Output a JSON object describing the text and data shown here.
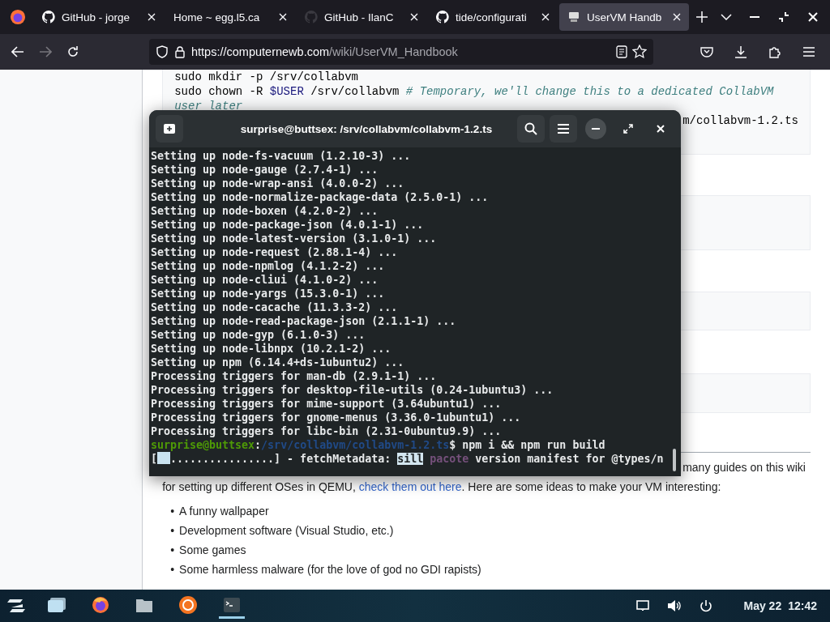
{
  "browser": {
    "tabs": [
      {
        "title": "GitHub - jorge",
        "kind": "github",
        "selected": false
      },
      {
        "title": "Home ~ egg.l5.ca",
        "kind": "plain",
        "selected": false
      },
      {
        "title": "GitHub - IlanC",
        "kind": "dim",
        "selected": false
      },
      {
        "title": "tide/configurati",
        "kind": "github",
        "selected": false
      },
      {
        "title": "UserVM Handb",
        "kind": "wiki",
        "selected": true
      }
    ],
    "url_host": "https://computernewb.com",
    "url_path": "/wiki/UserVM_Handbook"
  },
  "page": {
    "code_lines": [
      {
        "kind": "plain",
        "text": "sudo mkdir -p /srv/collabvm"
      },
      {
        "kind": "chown",
        "cmd": "sudo chown -R ",
        "var": "$USER",
        "rest": " /srv/collabvm ",
        "comment": "# Temporary, we'll change this to a dedicated CollabVM user later"
      },
      {
        "kind": "tail",
        "text": "m/collabvm-1.2.ts"
      }
    ],
    "paragraph_tail": "many guides on this wiki",
    "paragraph": {
      "before": "for setting up different OSes in QEMU, ",
      "link": "check them out here",
      "after": ". Here are some ideas to make your VM interesting:"
    },
    "list": [
      {
        "bullet": "•",
        "text": "A funny wallpaper"
      },
      {
        "bullet": "•",
        "text": "Development software (Visual Studio, etc.)"
      },
      {
        "bullet": "•",
        "text": "Some games"
      },
      {
        "bullet": "•",
        "text": "Some harmless malware (for the love of god no GDI rapists)"
      }
    ]
  },
  "terminal": {
    "title": "surprise@buttsex: /srv/collabvm/collabvm-1.2.ts",
    "lines": [
      "Setting up node-fs-vacuum (1.2.10-3) ...",
      "Setting up node-gauge (2.7.4-1) ...",
      "Setting up node-wrap-ansi (4.0.0-2) ...",
      "Setting up node-normalize-package-data (2.5.0-1) ...",
      "Setting up node-boxen (4.2.0-2) ...",
      "Setting up node-package-json (4.0.1-1) ...",
      "Setting up node-latest-version (3.1.0-1) ...",
      "Setting up node-request (2.88.1-4) ...",
      "Setting up node-npmlog (4.1.2-2) ...",
      "Setting up node-cliui (4.1.0-2) ...",
      "Setting up node-yargs (15.3.0-1) ...",
      "Setting up node-cacache (11.3.3-2) ...",
      "Setting up node-read-package-json (2.1.1-1) ...",
      "Setting up node-gyp (6.1.0-3) ...",
      "Setting up node-libnpx (10.2.1-2) ...",
      "Setting up npm (6.14.4+ds-1ubuntu2) ...",
      "Processing triggers for man-db (2.9.1-1) ...",
      "Processing triggers for desktop-file-utils (0.24-1ubuntu3) ...",
      "Processing triggers for mime-support (3.64ubuntu1) ...",
      "Processing triggers for gnome-menus (3.36.0-1ubuntu1) ...",
      "Processing triggers for libc-bin (2.31-0ubuntu9.9) ..."
    ],
    "prompt": {
      "user": "surprise@buttsex",
      "sep": ":",
      "path": "/srv/collabvm/collabvm-1.2.ts",
      "command": "$ npm i && npm run build"
    },
    "progress": {
      "open": "[",
      "dots": "................] - fetchMetadata: ",
      "level_tag": "sill",
      "module": "pacote",
      "rest": " version manifest for @types/n"
    }
  },
  "taskbar": {
    "apps": [
      {
        "kind": "windows",
        "active": false
      },
      {
        "kind": "firefox",
        "active": false
      },
      {
        "kind": "folder",
        "active": false
      },
      {
        "kind": "software",
        "active": false
      },
      {
        "kind": "terminal",
        "active": true
      }
    ],
    "date": "May 22",
    "time": "12:42"
  }
}
